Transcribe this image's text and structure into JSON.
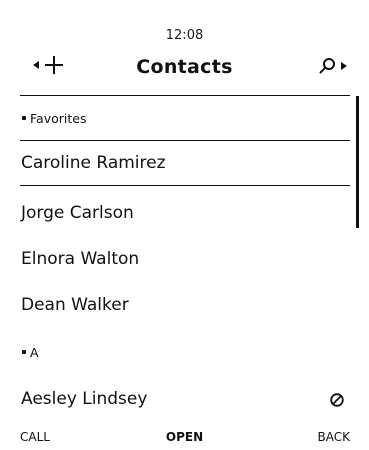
{
  "status_bar": {
    "time": "12:08"
  },
  "header": {
    "title": "Contacts",
    "left_icons": [
      "arrow-left-icon",
      "add-contact-icon"
    ],
    "right_icons": [
      "search-icon",
      "arrow-right-icon"
    ]
  },
  "list": {
    "favorites_header": "Favorites",
    "favorites": [
      {
        "name": "Caroline Ramirez",
        "selected": true
      },
      {
        "name": "Jorge Carlson"
      },
      {
        "name": "Elnora Walton"
      },
      {
        "name": "Dean Walker"
      }
    ],
    "section_a_header": "A",
    "section_a": [
      {
        "name": "Aesley Lindsey",
        "badge_icon": "blocked-icon"
      }
    ]
  },
  "softkeys": {
    "left": "CALL",
    "center": "OPEN",
    "right": "BACK"
  }
}
